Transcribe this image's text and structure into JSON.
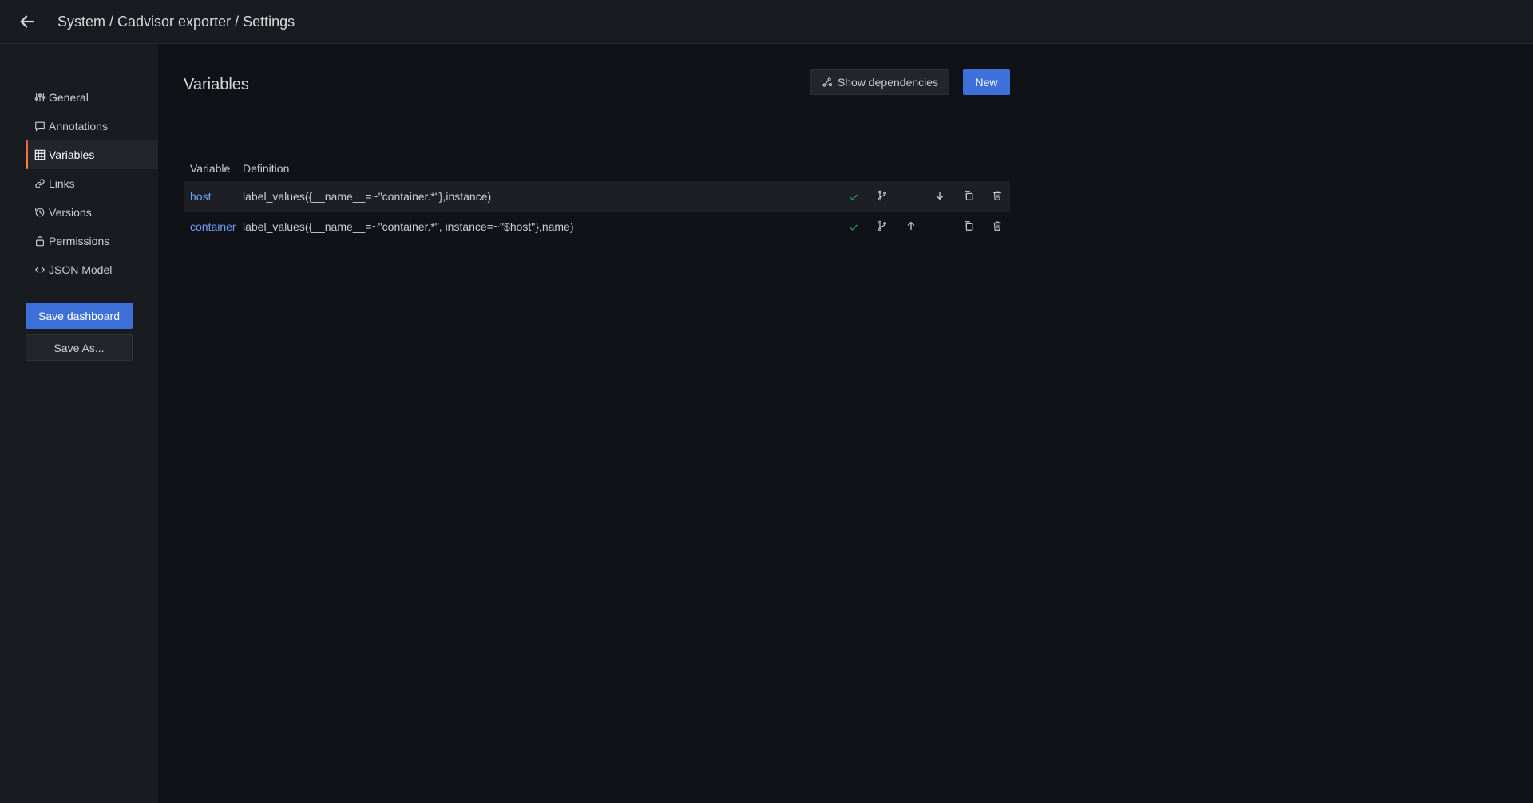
{
  "header": {
    "title": "System / Cadvisor exporter / Settings"
  },
  "sidebar": {
    "items": [
      {
        "label": "General",
        "icon": "sliders-icon"
      },
      {
        "label": "Annotations",
        "icon": "comment-icon"
      },
      {
        "label": "Variables",
        "icon": "table-icon",
        "active": true
      },
      {
        "label": "Links",
        "icon": "link-icon"
      },
      {
        "label": "Versions",
        "icon": "history-icon"
      },
      {
        "label": "Permissions",
        "icon": "lock-icon"
      },
      {
        "label": "JSON Model",
        "icon": "code-icon"
      }
    ],
    "save_label": "Save dashboard",
    "save_as_label": "Save As..."
  },
  "main": {
    "title": "Variables",
    "show_dependencies_label": "Show dependencies",
    "new_label": "New",
    "table": {
      "headers": [
        "Variable",
        "Definition"
      ],
      "rows": [
        {
          "name": "host",
          "definition": "label_values({__name__=~\"container.*\"},instance)"
        },
        {
          "name": "container",
          "definition": "label_values({__name__=~\"container.*\", instance=~\"$host\"},name)"
        }
      ]
    }
  },
  "colors": {
    "accent": "#3d71d9",
    "link": "#6e9fff",
    "success": "#1a9d5a",
    "active_indicator": "#f55f3e"
  }
}
